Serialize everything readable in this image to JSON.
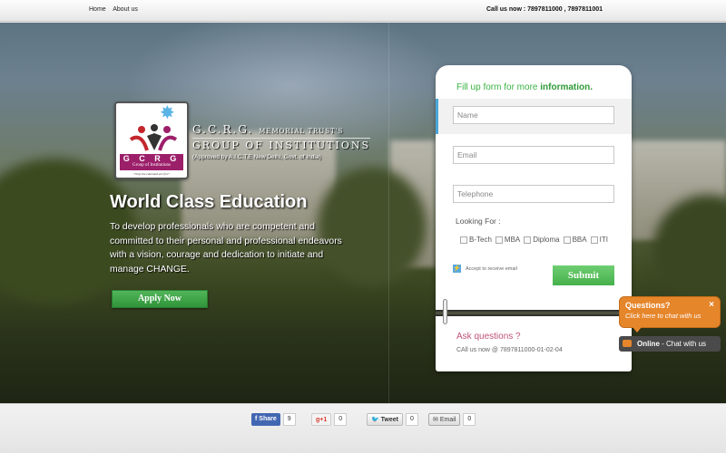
{
  "topbar": {
    "nav": [
      "Home",
      "About us"
    ],
    "call_label": "Call us now : ",
    "call_numbers": "7897811000 , 7897811001"
  },
  "logo": {
    "letters": "G C R G",
    "band_text": "Group of Institutions",
    "motto": "\"Only the educated are free\"",
    "trust_line1_big": "G.C.R.G.",
    "trust_line1_small": "MEMORIAL TRUST'S",
    "trust_line2": "GROUP OF INSTITUTIONS",
    "approval": "(Approved by A.I.C.T.E New Delhi, Govt.  of India)"
  },
  "hero": {
    "headline": "World Class Education",
    "description": "To develop professionals who are competent and committed to their personal and professional endeavors with a vision, courage and dedication to initiate and manage CHANGE.",
    "apply_label": "Apply Now"
  },
  "form": {
    "title_prefix": "Fill up form for more ",
    "title_bold": "information.",
    "name_placeholder": "Name",
    "email_placeholder": "Email",
    "phone_placeholder": "Telephone",
    "looking_for": "Looking For :",
    "options": [
      "B-Tech",
      "MBA",
      "Diploma",
      "BBA",
      "ITI"
    ],
    "accept_label": "Accept to receive email",
    "submit_label": "Submit",
    "ask_title": "Ask questions ?",
    "call_now": "CAll us now @ 7897811000-01-02-04",
    "accent": "#3bb343"
  },
  "chat": {
    "questions_title": "Questions?",
    "questions_sub": "Click here to chat with us",
    "close": "×",
    "online_bold": "Online",
    "online_rest": " - Chat with us"
  },
  "share": {
    "facebook": {
      "label": "Share",
      "count": "9"
    },
    "gplus": {
      "label": "g+1",
      "count": "0"
    },
    "twitter": {
      "label": "Tweet",
      "count": "0"
    },
    "email": {
      "label": "Email",
      "count": "0"
    }
  }
}
